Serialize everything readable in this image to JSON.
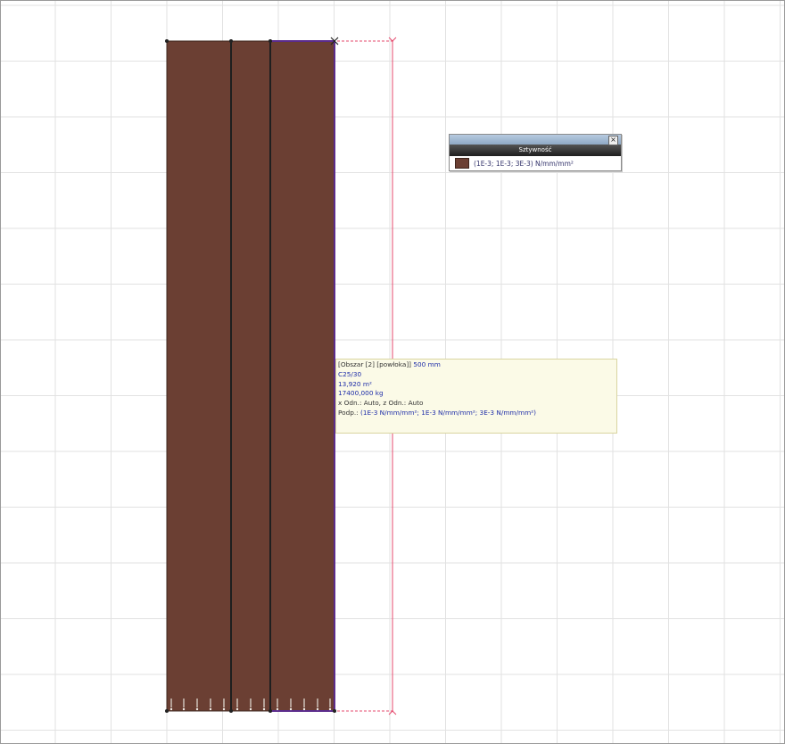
{
  "colors": {
    "grid": "#e2e2e2",
    "panel_fill": "#6b3f33",
    "panel_edge": "#3f2a22",
    "selected_edge": "#5b2c8c",
    "dimension": "#e64a6e",
    "tooltip_bg": "#fbfae7",
    "tooltip_text": "#1d2ca8"
  },
  "legend": {
    "title": "Sztywność",
    "close_icon": "×",
    "entry_label": "(1E-3; 1E-3; 3E-3) N/mm/mm²"
  },
  "tooltip": {
    "line1_prefix": "[Obszar [2] [powłoka]]",
    "line1_value": "500 mm",
    "material": "C25/30",
    "area": "13,920 m²",
    "mass": "17400,000 kg",
    "line5": "x Odn.: Auto, z Odn.: Auto",
    "line6_prefix": "Podp.:",
    "line6_value": "(1E-3 N/mm/mm²; 1E-3 N/mm/mm²; 3E-3 N/mm/mm²)"
  }
}
